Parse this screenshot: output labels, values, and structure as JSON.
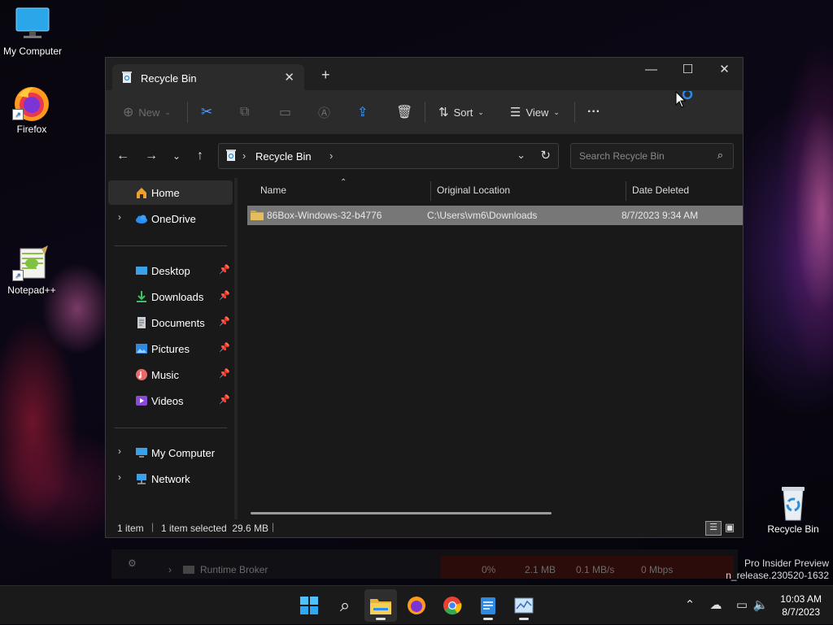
{
  "desktop": {
    "icons": [
      {
        "label": "My Computer"
      },
      {
        "label": "Firefox"
      },
      {
        "label": "Notepad++"
      },
      {
        "label": "Recycle Bin"
      }
    ],
    "watermark_line1": "Pro Insider Preview",
    "watermark_line2": "n_release.230520-1632"
  },
  "background_window": {
    "process": "Runtime Broker",
    "cpu": "0%",
    "memory": "2.1 MB",
    "disk": "0.1 MB/s",
    "network": "0 Mbps"
  },
  "explorer": {
    "tab_title": "Recycle Bin",
    "new_tab_icon": "plus-icon",
    "toolbar": {
      "new_label": "New",
      "sort_label": "Sort",
      "view_label": "View",
      "more_label": "···"
    },
    "address": {
      "crumb": "Recycle Bin"
    },
    "search": {
      "placeholder": "Search Recycle Bin"
    },
    "nav": {
      "home": "Home",
      "onedrive": "OneDrive",
      "quick": [
        {
          "label": "Desktop",
          "icon": "desktop-icon"
        },
        {
          "label": "Downloads",
          "icon": "downloads-icon"
        },
        {
          "label": "Documents",
          "icon": "documents-icon"
        },
        {
          "label": "Pictures",
          "icon": "pictures-icon"
        },
        {
          "label": "Music",
          "icon": "music-icon"
        },
        {
          "label": "Videos",
          "icon": "videos-icon"
        }
      ],
      "my_computer": "My Computer",
      "network": "Network"
    },
    "columns": {
      "name": "Name",
      "original_location": "Original Location",
      "date_deleted": "Date Deleted"
    },
    "rows": [
      {
        "name": "86Box-Windows-32-b4776",
        "original_location": "C:\\Users\\vm6\\Downloads",
        "date_deleted": "8/7/2023 9:34 AM"
      }
    ],
    "status": {
      "item_count": "1 item",
      "selection": "1 item selected  29.6 MB"
    }
  },
  "taskbar": {
    "apps": [
      "start-icon",
      "search-icon",
      "file-explorer-icon",
      "firefox-icon",
      "chrome-icon",
      "notepad-icon",
      "task-manager-icon"
    ],
    "time": "10:03 AM",
    "date": "8/7/2023"
  },
  "colors": {
    "accent": "#0078d4",
    "window_bg": "#191919",
    "toolbar_bg": "#2b2b2b",
    "selected_row": "#777777"
  }
}
